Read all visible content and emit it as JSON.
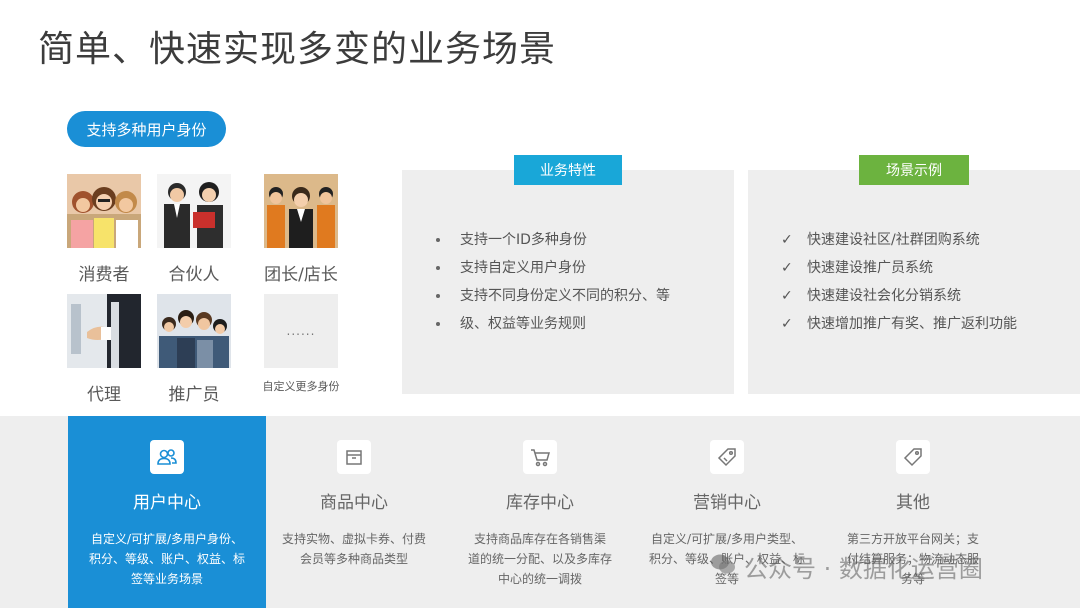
{
  "page": {
    "title": "简单、快速实现多变的业务场景"
  },
  "user_types": {
    "pill_label": "支持多种用户身份",
    "personas": [
      {
        "label": "消费者"
      },
      {
        "label": "合伙人"
      },
      {
        "label": "团长/店长"
      },
      {
        "label": "代理"
      },
      {
        "label": "推广员"
      },
      {
        "label": "自定义更多身份",
        "placeholder": "......"
      }
    ]
  },
  "features": {
    "tag": "业务特性",
    "items": [
      "支持一个ID多种身份",
      "支持自定义用户身份",
      "支持不同身份定义不同的积分、等",
      "级、权益等业务规则"
    ]
  },
  "scenes": {
    "tag": "场景示例",
    "items": [
      "快速建设社区/社群团购系统",
      "快速建设推广员系统",
      "快速建设社会化分销系统",
      "快速增加推广有奖、推广返利功能"
    ],
    "check_glyph": "✓"
  },
  "modules": [
    {
      "title": "用户中心",
      "icon": "users-icon",
      "desc": [
        "自定义/可扩展/多用户身份、",
        "积分、等级、账户、权益、标",
        "签等业务场景"
      ],
      "active": true
    },
    {
      "title": "商品中心",
      "icon": "box-icon",
      "desc": [
        "支持实物、虚拟卡券、付费",
        "会员等多种商品类型"
      ]
    },
    {
      "title": "库存中心",
      "icon": "cart-icon",
      "desc": [
        "支持商品库存在各销售渠",
        "道的统一分配、以及多库存",
        "中心的统一调拨"
      ]
    },
    {
      "title": "营销中心",
      "icon": "tag-icon",
      "desc": [
        "自定义/可扩展/多用户类型、",
        "积分、等级、账户、权益、标",
        "签等"
      ]
    },
    {
      "title": "其他",
      "icon": "tag-icon",
      "desc": [
        "第三方开放平台网关；支",
        "付结算服务；物流动态服",
        "务等"
      ]
    }
  ],
  "watermark": {
    "text": "公众号 · 数据化运营圈"
  },
  "colors": {
    "accent_blue": "#1a8fd6",
    "tag_cyan": "#19a7d8",
    "tag_green": "#6cb33f",
    "panel_gray": "#eeeeee"
  }
}
